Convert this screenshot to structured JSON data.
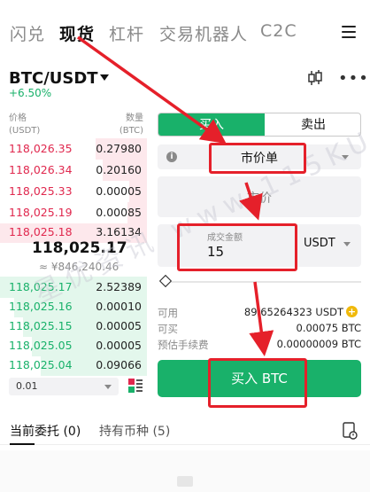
{
  "nav": {
    "tabs": [
      "闪兑",
      "现货",
      "杠杆",
      "交易机器人",
      "C2C"
    ],
    "active_tab": "现货"
  },
  "pair": {
    "symbol": "BTC/USDT",
    "change_pct": "+6.50%"
  },
  "orderbook": {
    "price_header": "价格\n(USDT)",
    "qty_header": "数量\n(BTC)",
    "asks": [
      {
        "price": "118,026.35",
        "qty": "0.27980"
      },
      {
        "price": "118,026.34",
        "qty": "0.20160"
      },
      {
        "price": "118,025.33",
        "qty": "0.00005"
      },
      {
        "price": "118,025.19",
        "qty": "0.00085"
      },
      {
        "price": "118,025.18",
        "qty": "3.16134"
      }
    ],
    "mid_price": "118,025.17",
    "mid_cny": "≈ ¥846,240.46",
    "bids": [
      {
        "price": "118,025.17",
        "qty": "2.52389"
      },
      {
        "price": "118,025.16",
        "qty": "0.00010"
      },
      {
        "price": "118,025.15",
        "qty": "0.00005"
      },
      {
        "price": "118,025.05",
        "qty": "0.00005"
      },
      {
        "price": "118,025.04",
        "qty": "0.09066"
      }
    ],
    "depth_value": "0.01"
  },
  "trade": {
    "buy_tab": "买入",
    "sell_tab": "卖出",
    "order_type": "市价单",
    "price_placeholder": "市价",
    "amount_label": "成交金额",
    "amount_value": "15",
    "amount_unit": "USDT",
    "available_label": "可用",
    "available_value": "89.65264323 USDT",
    "can_buy_label": "可买",
    "can_buy_value": "0.00075 BTC",
    "fee_label": "预估手续费",
    "fee_value": "0.00000009 BTC",
    "buy_button": "买入 BTC"
  },
  "bottom_tabs": {
    "orders": "当前委托 (0)",
    "holdings": "持有币种 (5)"
  },
  "watermark": "星优资讯 www.115KU.com",
  "colors": {
    "green": "#19b16a",
    "red": "#e0284e",
    "annotation_red": "#e5202a"
  }
}
